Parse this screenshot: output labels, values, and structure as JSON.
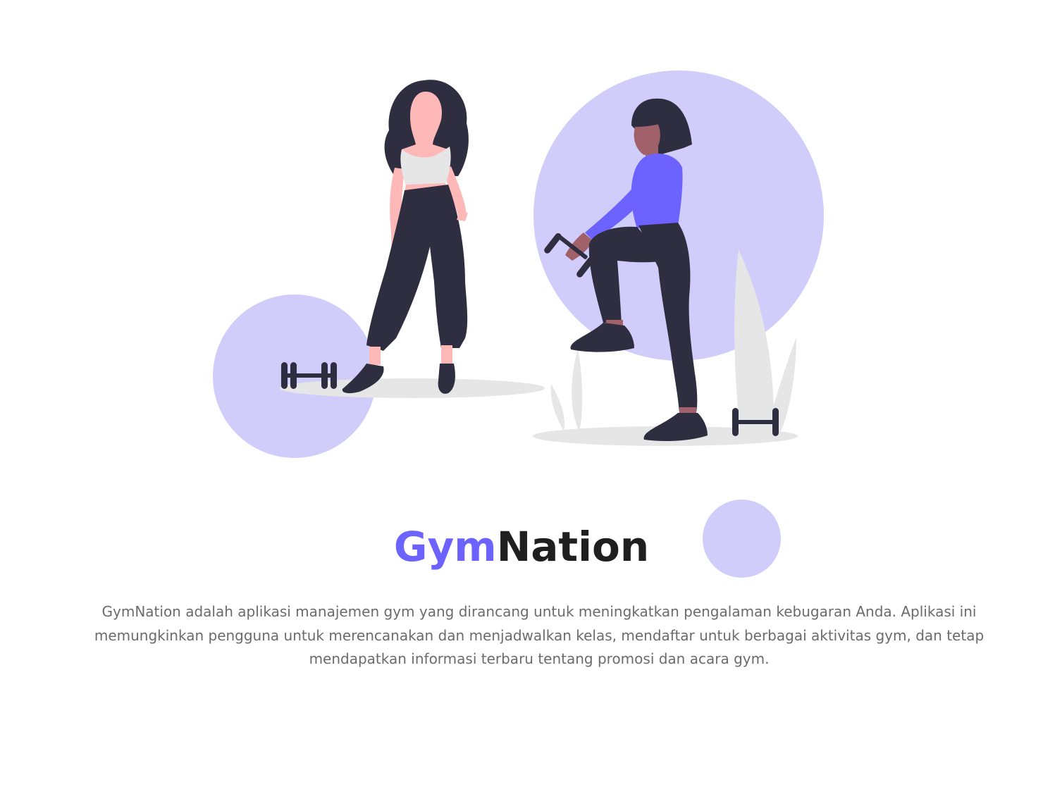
{
  "app": {
    "title_part1": "Gym",
    "title_part2": "Nation",
    "description": "GymNation adalah aplikasi manajemen gym yang dirancang untuk meningkatkan pengalaman kebugaran Anda. Aplikasi ini memungkinkan pengguna untuk merencanakan dan menjadwalkan kelas, mendaftar untuk berbagai aktivitas gym, dan tetap mendapatkan informasi terbaru tentang promosi dan acara gym."
  },
  "colors": {
    "brand": "#6C63FF",
    "dark": "#2F2E41",
    "circle": "#D0CDFB",
    "shadow": "#E6E6E6",
    "skin_light": "#FFB8B8",
    "skin_dark": "#A0616A",
    "top_light": "#E6E6E6",
    "title_dark": "#1f1f1f",
    "body_text": "#6b6b6b"
  },
  "illustration": {
    "subject": "two-women-exercising-with-dumbbells"
  }
}
